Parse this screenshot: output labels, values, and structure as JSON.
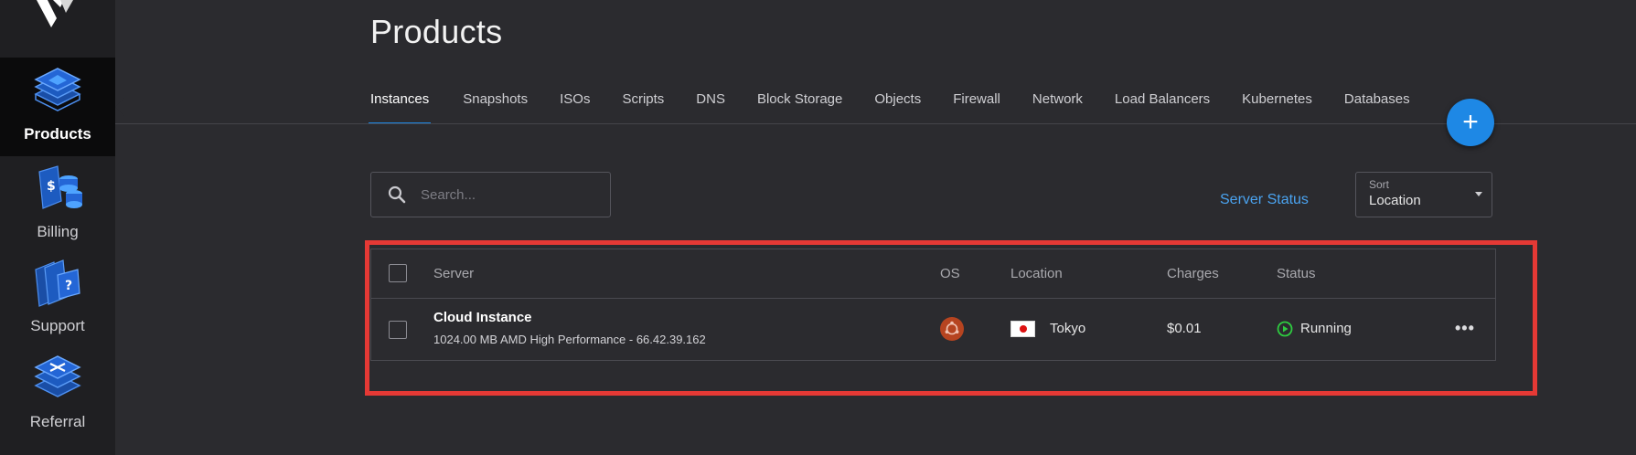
{
  "sidebar": {
    "items": [
      {
        "label": "Products",
        "icon": "products-stack-icon",
        "active": true
      },
      {
        "label": "Billing",
        "icon": "billing-icon",
        "active": false
      },
      {
        "label": "Support",
        "icon": "support-icon",
        "active": false
      },
      {
        "label": "Referral",
        "icon": "referral-icon",
        "active": false
      }
    ]
  },
  "page": {
    "title": "Products"
  },
  "tabs": [
    {
      "label": "Instances",
      "active": true
    },
    {
      "label": "Snapshots"
    },
    {
      "label": "ISOs"
    },
    {
      "label": "Scripts"
    },
    {
      "label": "DNS"
    },
    {
      "label": "Block Storage"
    },
    {
      "label": "Objects"
    },
    {
      "label": "Firewall"
    },
    {
      "label": "Network"
    },
    {
      "label": "Load Balancers"
    },
    {
      "label": "Kubernetes"
    },
    {
      "label": "Databases"
    }
  ],
  "fab": {
    "label": "+"
  },
  "search": {
    "placeholder": "Search..."
  },
  "server_status_link": "Server Status",
  "sort": {
    "label": "Sort",
    "value": "Location"
  },
  "table": {
    "headers": [
      "Server",
      "OS",
      "Location",
      "Charges",
      "Status"
    ],
    "rows": [
      {
        "server_name": "Cloud Instance",
        "server_details": "1024.00 MB AMD High Performance - 66.42.39.162",
        "os_icon": "ubuntu-icon",
        "location": "Tokyo",
        "location_flag": "japan-flag-icon",
        "charges": "$0.01",
        "status": "Running",
        "actions": "•••"
      }
    ]
  },
  "colors": {
    "accent": "#1e88e5",
    "link": "#4aa3f0",
    "status_running": "#2ecc40",
    "highlight": "#e53935",
    "ubuntu": "#b64420"
  }
}
